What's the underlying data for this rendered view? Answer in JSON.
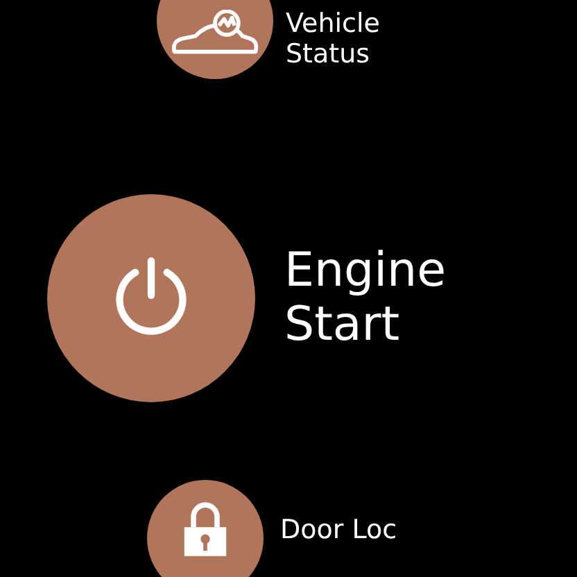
{
  "actions": [
    {
      "kind": "car",
      "label": "Vehicle Status",
      "selected": false
    },
    {
      "kind": "power",
      "label": "Engine Start",
      "selected": true
    },
    {
      "kind": "lock",
      "label": "Door Loc",
      "selected": false
    }
  ]
}
